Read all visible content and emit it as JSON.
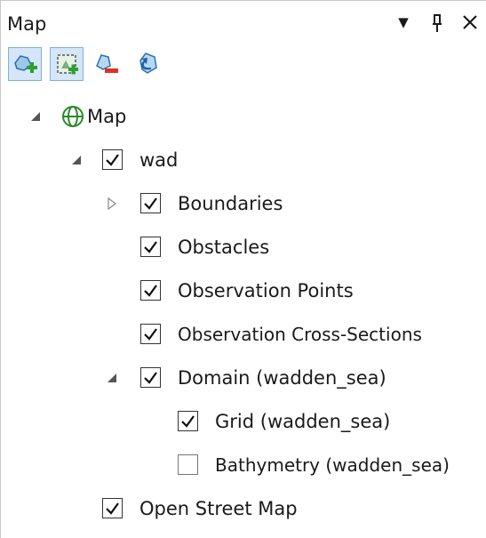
{
  "panel": {
    "title": "Map",
    "dropdown_glyph": "▼",
    "pin_glyph": "📌",
    "pin_text": "ᵖ",
    "close_glyph": "✕"
  },
  "toolbar": {
    "tools": [
      {
        "icon": "add-layer-icon",
        "active": true
      },
      {
        "icon": "add-map-icon",
        "active": true
      },
      {
        "icon": "remove-layer-icon",
        "active": false
      },
      {
        "icon": "undo-layer-icon",
        "active": false
      }
    ]
  },
  "tree": {
    "root": {
      "label": "Map",
      "icon": "globe-icon",
      "expanded": true
    },
    "wad": {
      "label": "wad",
      "checked": true,
      "expanded": true
    },
    "boundaries": {
      "label": "Boundaries",
      "checked": true,
      "expanded": false
    },
    "obstacles": {
      "label": "Obstacles",
      "checked": true
    },
    "observation_points": {
      "label": "Observation Points",
      "checked": true
    },
    "observation_cross_sections": {
      "label": "Observation Cross-Sections",
      "checked": true
    },
    "domain": {
      "label": "Domain (wadden_sea)",
      "checked": true,
      "expanded": true
    },
    "grid": {
      "label": "Grid (wadden_sea)",
      "checked": true
    },
    "bathymetry": {
      "label": "Bathymetry (wadden_sea)",
      "checked": false
    },
    "osm": {
      "label": "Open Street Map",
      "checked": true
    }
  }
}
